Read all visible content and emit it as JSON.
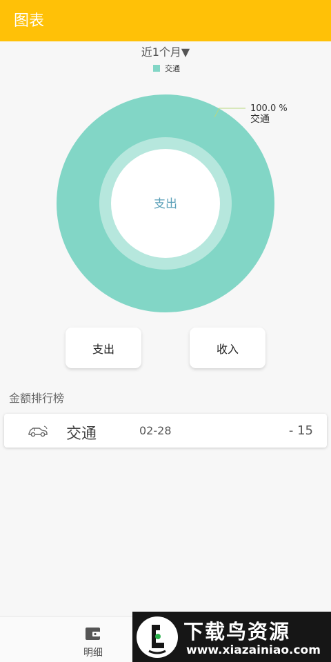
{
  "appbar": {
    "title": "图表"
  },
  "filter": {
    "period": "近1个月▼"
  },
  "chart_data": {
    "type": "pie",
    "categories": [
      "交通"
    ],
    "values": [
      100.0
    ],
    "colors": [
      "#82d6c6"
    ],
    "center_label": "支出",
    "slice_label_value": "100.0 %",
    "slice_label_name": "交通",
    "legend": [
      "交通"
    ],
    "legend_position": "top-center"
  },
  "toggle": {
    "expense_label": "支出",
    "income_label": "收入"
  },
  "ranking": {
    "title": "金额排行榜",
    "items": [
      {
        "icon": "car-icon",
        "name": "交通",
        "date": "02-28",
        "amount": "- 15"
      }
    ]
  },
  "bottom_nav": {
    "items": [
      {
        "icon": "wallet-icon",
        "label": "明细"
      }
    ]
  },
  "watermark": {
    "title": "下载鸟资源",
    "url": "www.xiazainiao.com"
  },
  "colors": {
    "appbar": "#ffc107",
    "chart_primary": "#82d6c6",
    "center_text": "#5ba0b8",
    "background": "#f7f7f7"
  }
}
